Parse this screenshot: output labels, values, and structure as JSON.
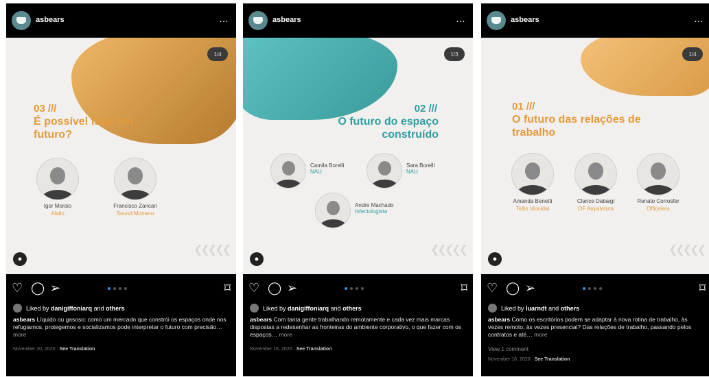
{
  "posts": [
    {
      "username": "asbears",
      "counter": "1/4",
      "number": "03 ///",
      "title": "É possível falar em futuro?",
      "people": [
        {
          "name": "Igor Moraio",
          "org": "Alalio"
        },
        {
          "name": "Francisco Zancan",
          "org": "Sound Montero"
        }
      ],
      "liked_by_prefix": "Liked by",
      "liked_by_user": "danigiffoniarq",
      "liked_by_and": "and",
      "liked_by_others": "others",
      "caption_user": "asbears",
      "caption_text": "Líquido ou gasoso: como um mercado que constrói os espaços onde nos refugiamos, protegemos e socializamos pode interpretar o futuro com precisão…",
      "more": "more",
      "comments": "",
      "date": "November 20, 2020",
      "see_translation": "See Translation"
    },
    {
      "username": "asbears",
      "counter": "1/3",
      "number": "02 ///",
      "title": "O futuro do espaço construído",
      "people": [
        {
          "name": "Camila Borelli",
          "org": "NAU"
        },
        {
          "name": "Sara Borelli",
          "org": "NAU"
        },
        {
          "name": "Andre Machado",
          "org": "Infectologista"
        }
      ],
      "liked_by_prefix": "Liked by",
      "liked_by_user": "danigiffoniarq",
      "liked_by_and": "and",
      "liked_by_others": "others",
      "caption_user": "asbears",
      "caption_text": "Com tanta gente trabalhando remotamente e cada vez mais marcas dispostas a redesenhar as fronteiras do ambiente corporativo, o que fazer com os espaços…",
      "more": "more",
      "comments": "",
      "date": "November 18, 2020",
      "see_translation": "See Translation"
    },
    {
      "username": "asbears",
      "counter": "1/4",
      "number": "01 ///",
      "title": "O futuro das relações de trabalho",
      "people": [
        {
          "name": "Amanda Benetti",
          "org": "Tellis Vionidal"
        },
        {
          "name": "Clarice Dabaigi",
          "org": "OF Arquitetura"
        },
        {
          "name": "Renato Corrosfer",
          "org": "Officelers"
        }
      ],
      "liked_by_prefix": "Liked by",
      "liked_by_user": "luarndt",
      "liked_by_and": "and",
      "liked_by_others": "others",
      "caption_user": "asbears",
      "caption_text": "Como os escritórios podem se adaptar à nova rotina de trabalho, às vezes remoto, às vezes presencial? Das relações de trabalho, passando pelos contratos e até…",
      "more": "more",
      "comments": "View 1 comment",
      "date": "November 16, 2020",
      "see_translation": "See Translation"
    }
  ],
  "icons": {
    "more": "…",
    "heart": "♡",
    "comment": "◯",
    "share": "➢",
    "save": "⌑",
    "user": "●",
    "chevrons": "❮❮❮❮❮"
  },
  "colors": {
    "orange": "#e29b3c",
    "teal": "#2f9ea0",
    "dark": "#000000",
    "link_blue": "#3a8fe0"
  }
}
